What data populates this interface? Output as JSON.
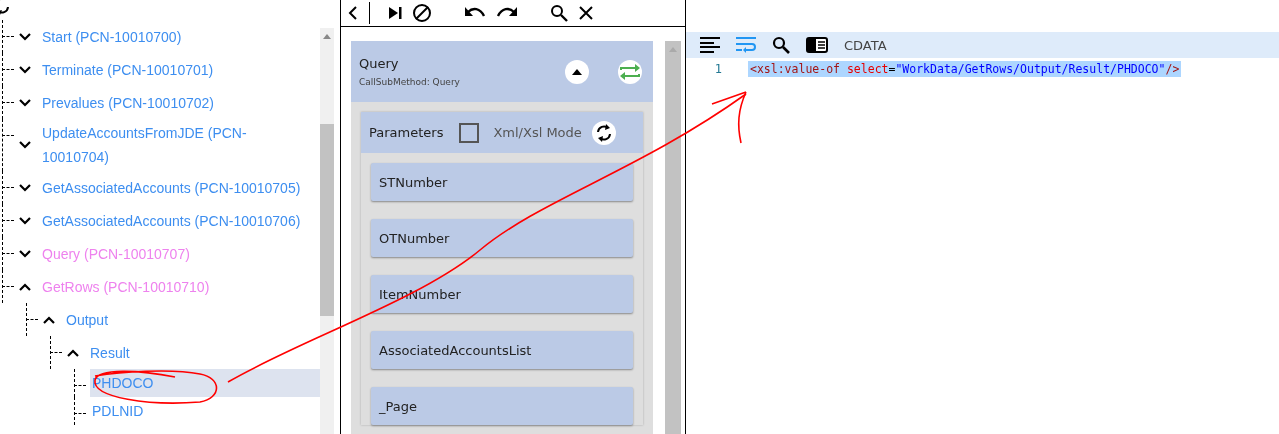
{
  "tree": {
    "items": [
      {
        "label": "Start (PCN-10010700)",
        "color": "#3d8ef0",
        "expanded": false,
        "selected": false
      },
      {
        "label": "Terminate (PCN-10010701)",
        "color": "#3d8ef0",
        "expanded": false,
        "selected": false
      },
      {
        "label": "Prevalues (PCN-10010702)",
        "color": "#3d8ef0",
        "expanded": false,
        "selected": false
      },
      {
        "label": "UpdateAccountsFromJDE (PCN-10010704)",
        "color": "#3d8ef0",
        "expanded": false,
        "selected": false
      },
      {
        "label": "GetAssociatedAccounts (PCN-10010705)",
        "color": "#3d8ef0",
        "expanded": false,
        "selected": false
      },
      {
        "label": "GetAssociatedAccounts (PCN-10010706)",
        "color": "#3d8ef0",
        "expanded": false,
        "selected": false
      },
      {
        "label": "Query (PCN-10010707)",
        "color": "#ee82ee",
        "expanded": false,
        "selected": false
      },
      {
        "label": "GetRows (PCN-10010710)",
        "color": "#ee82ee",
        "expanded": true,
        "selected": false,
        "children": [
          {
            "label": "Output",
            "color": "#3d8ef0",
            "expanded": true,
            "selected": false,
            "children": [
              {
                "label": "Result",
                "color": "#3d8ef0",
                "expanded": true,
                "selected": false,
                "children": [
                  {
                    "label": "PHDOCO",
                    "color": "#3d8ef0",
                    "selected": true
                  },
                  {
                    "label": "PDLNID",
                    "color": "#3d8ef0",
                    "selected": false
                  }
                ]
              }
            ]
          }
        ]
      }
    ]
  },
  "activity": {
    "title": "Query",
    "subtitle": "CallSubMethod: Query",
    "parameters": {
      "title": "Parameters",
      "xml_mode": {
        "label": "Xml/Xsl Mode",
        "checked": false
      },
      "items": [
        "STNumber",
        "OTNumber",
        "ItemNumber",
        "AssociatedAccountsList",
        "_Page"
      ]
    }
  },
  "editor": {
    "toolbar": {
      "wrap_on": true,
      "label": "CDATA"
    },
    "lines": [
      {
        "number": "1",
        "selected": true,
        "tokens": [
          {
            "kind": "tag",
            "text": "<xsl:value-of"
          },
          {
            "kind": "attr",
            "text": " select"
          },
          {
            "kind": "plain",
            "text": "="
          },
          {
            "kind": "string",
            "text": "\"WorkData/GetRows/Output/Result/PHDOCO\""
          },
          {
            "kind": "tag",
            "text": "/>"
          }
        ]
      }
    ]
  }
}
